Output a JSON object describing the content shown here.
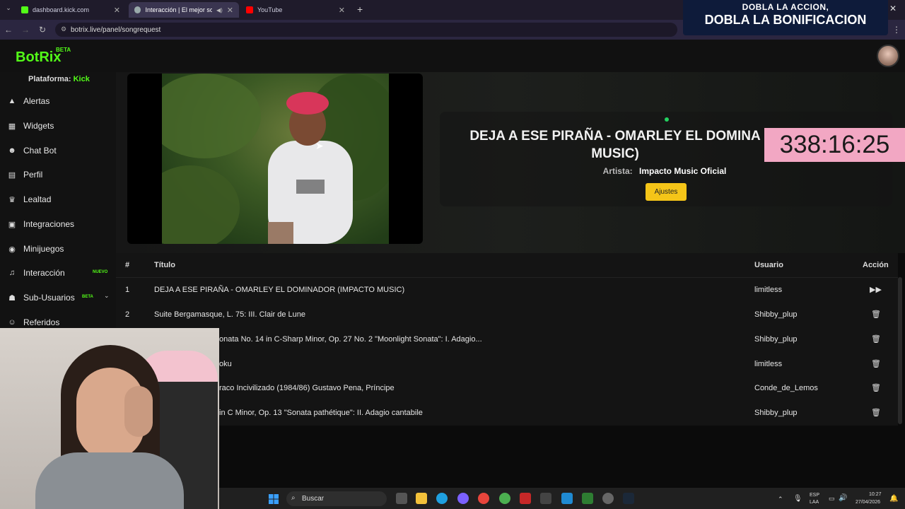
{
  "browser": {
    "tabs": [
      {
        "label": "dashboard.kick.com"
      },
      {
        "label": "Interacción | El mejor softw"
      },
      {
        "label": "YouTube"
      }
    ],
    "url": "botrix.live/panel/songrequest"
  },
  "promo": {
    "line1": "DOBLA LA ACCION,",
    "line2": "DOBLA LA BONIFICACION"
  },
  "app": {
    "logo": "BotRix",
    "logo_badge": "BETA"
  },
  "sidebar": {
    "platform_label": "Plataforma:",
    "platform_value": "Kick",
    "items": [
      {
        "label": "Alertas",
        "icon": "warning-icon"
      },
      {
        "label": "Widgets",
        "icon": "grid-icon"
      },
      {
        "label": "Chat Bot",
        "icon": "robot-icon"
      },
      {
        "label": "Perfil",
        "icon": "id-card-icon"
      },
      {
        "label": "Lealtad",
        "icon": "trophy-icon"
      },
      {
        "label": "Integraciones",
        "icon": "plug-icon"
      },
      {
        "label": "Minijuegos",
        "icon": "gamepad-icon"
      },
      {
        "label": "Interacción",
        "icon": "music-icon",
        "badge": "NUEVO"
      },
      {
        "label": "Sub-Usuarios",
        "icon": "users-icon",
        "badge": "BETA"
      },
      {
        "label": "Referidos",
        "icon": "user-group-icon"
      }
    ]
  },
  "now_playing": {
    "title": "DEJA A ESE PIRAÑA - OMARLEY EL DOMINA MUSIC)",
    "artist_label": "Artista:",
    "artist": "Impacto Music Oficial",
    "settings_label": "Ajustes"
  },
  "timer": "338:16:25",
  "table": {
    "headers": {
      "num": "#",
      "title": "Título",
      "user": "Usuario",
      "action": "Acción"
    },
    "rows": [
      {
        "num": "1",
        "title": "DEJA A ESE PIRAÑA - OMARLEY EL DOMINADOR (IMPACTO MUSIC)",
        "user": "limitless",
        "action": "skip"
      },
      {
        "num": "2",
        "title": "Suite Bergamasque, L. 75: III. Clair de Lune",
        "user": "Shibby_plup",
        "action": "delete"
      },
      {
        "num": "",
        "title": "onata No. 14 in C-Sharp Minor, Op. 27 No. 2 \"Moonlight Sonata\": I. Adagio...",
        "user": "Shibby_plup",
        "action": "delete"
      },
      {
        "num": "",
        "title": "oku",
        "user": "limitless",
        "action": "delete"
      },
      {
        "num": "",
        "title": "raco Incivilizado (1984/86) Gustavo Pena, Príncipe",
        "user": "Conde_de_Lemos",
        "action": "delete"
      },
      {
        "num": "",
        "title": "in C Minor, Op. 13 \"Sonata pathétique\": II. Adagio cantabile",
        "user": "Shibby_plup",
        "action": "delete"
      }
    ]
  },
  "taskbar": {
    "search_placeholder": "Buscar",
    "lang": "ESP",
    "lang_sub": "LAA",
    "time": "10:27",
    "date": "27/04/2026"
  },
  "colors": {
    "accent": "#53fc18",
    "button": "#f5c518",
    "timer_bg": "#f2a7c3"
  }
}
